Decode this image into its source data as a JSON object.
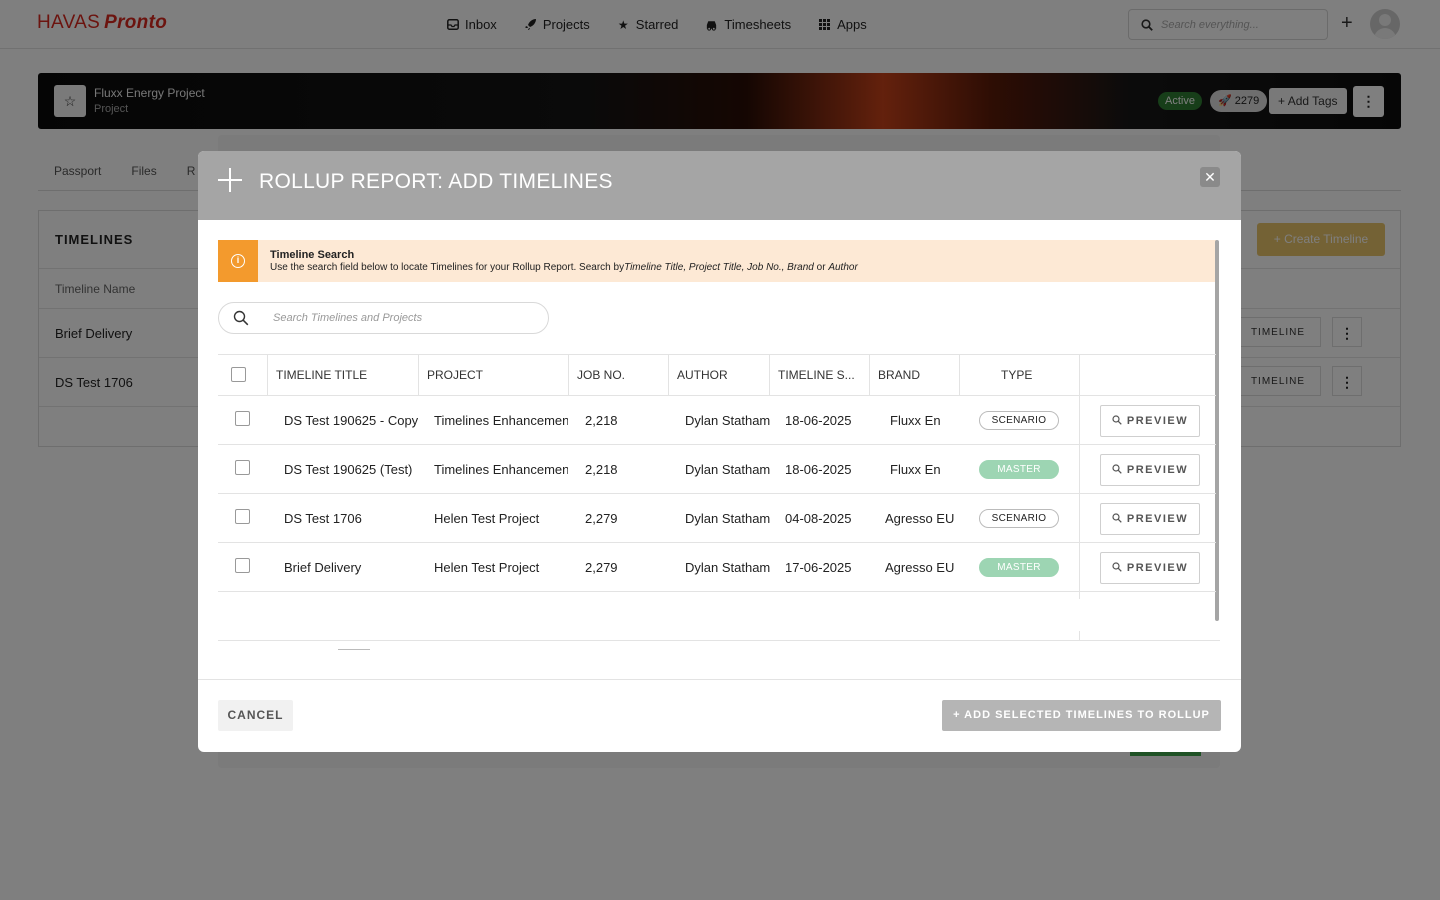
{
  "app": {
    "logo_brand": "HAVAS",
    "logo_product": "Pronto",
    "nav": [
      {
        "label": "Inbox",
        "icon": "inbox-icon"
      },
      {
        "label": "Projects",
        "icon": "rocket-icon"
      },
      {
        "label": "Starred",
        "icon": "star-icon"
      },
      {
        "label": "Timesheets",
        "icon": "car-icon"
      },
      {
        "label": "Apps",
        "icon": "grid-icon"
      }
    ],
    "search_placeholder": "Search everything..."
  },
  "project": {
    "title": "Fluxx Energy Project",
    "subtitle": "Project",
    "status": "Active",
    "job_count": "2279",
    "add_tags_label": "Add Tags"
  },
  "page_tabs": [
    "Passport",
    "Files",
    "R"
  ],
  "timelines_panel": {
    "heading": "TIMELINES",
    "create_label": "Create Timeline",
    "column": "Timeline Name",
    "rows": [
      {
        "name": "Brief Delivery",
        "action": "TIMELINE"
      },
      {
        "name": "DS Test 1706",
        "action": "TIMELINE"
      }
    ]
  },
  "modal": {
    "title": "ROLLUP REPORT: ADD TIMELINES",
    "info": {
      "title": "Timeline Search",
      "text_prefix": "Use the search field below to locate Timelines for your Rollup Report. Search by",
      "text_fields": "Timeline Title, Project Title, Job No., Brand",
      "text_or": " or ",
      "text_last": "Author"
    },
    "search_placeholder": "Search Timelines and Projects",
    "columns": [
      "TIMELINE TITLE",
      "PROJECT",
      "JOB NO.",
      "AUTHOR",
      "TIMELINE S...",
      "BRAND",
      "TYPE"
    ],
    "rows": [
      {
        "title": "DS Test 190625 - Copy",
        "project": "Timelines Enhancement",
        "job_no": "2,218",
        "author": "Dylan Statham",
        "start": "18-06-2025",
        "brand": "Fluxx En",
        "type": "SCENARIO"
      },
      {
        "title": "DS Test 190625 (Test)",
        "project": "Timelines Enhancement",
        "job_no": "2,218",
        "author": "Dylan Statham",
        "start": "18-06-2025",
        "brand": "Fluxx En",
        "type": "MASTER"
      },
      {
        "title": "DS Test 1706",
        "project": "Helen Test Project",
        "job_no": "2,279",
        "author": "Dylan Statham",
        "start": "04-08-2025",
        "brand": "Agresso EU",
        "type": "SCENARIO"
      },
      {
        "title": "Brief Delivery",
        "project": "Helen Test Project",
        "job_no": "2,279",
        "author": "Dylan Statham",
        "start": "17-06-2025",
        "brand": "Agresso EU",
        "type": "MASTER"
      }
    ],
    "preview_label": "PREVIEW",
    "cancel_label": "CANCEL",
    "add_label": "+ ADD SELECTED TIMELINES TO ROLLUP",
    "colors": {
      "header": "#a5a5a5",
      "info_accent": "#f39a2d",
      "info_bg": "#fde9d5",
      "master": "#9dd5b3"
    }
  }
}
